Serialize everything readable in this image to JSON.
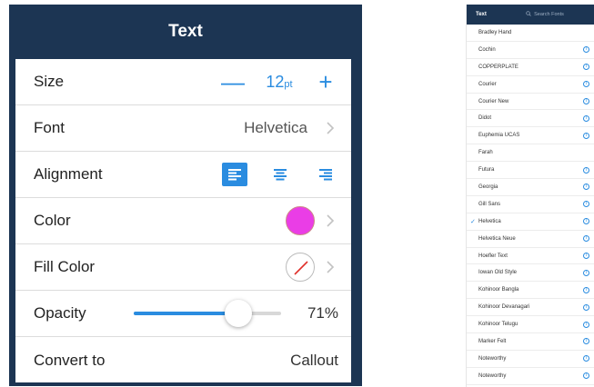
{
  "text_panel": {
    "title": "Text",
    "size": {
      "label": "Size",
      "minus": "—",
      "value": "12",
      "unit": "pt",
      "plus": "+"
    },
    "font": {
      "label": "Font",
      "value": "Helvetica"
    },
    "alignment": {
      "label": "Alignment",
      "selected": "left"
    },
    "color": {
      "label": "Color",
      "swatch": "#ea3de6"
    },
    "fill_color": {
      "label": "Fill Color",
      "swatch": "none"
    },
    "opacity": {
      "label": "Opacity",
      "value_text": "71%",
      "level": 0.71
    },
    "convert_to": {
      "label": "Convert to",
      "value": "Callout"
    }
  },
  "font_list": {
    "tab_label": "Text",
    "search_placeholder": "Search Fonts",
    "fonts": [
      {
        "name": "Bradley Hand",
        "info": false,
        "checked": false
      },
      {
        "name": "Cochin",
        "info": true,
        "checked": false
      },
      {
        "name": "COPPERPLATE",
        "info": true,
        "checked": false
      },
      {
        "name": "Courier",
        "info": true,
        "checked": false
      },
      {
        "name": "Courier New",
        "info": true,
        "checked": false
      },
      {
        "name": "Didot",
        "info": true,
        "checked": false
      },
      {
        "name": "Euphemia UCAS",
        "info": true,
        "checked": false
      },
      {
        "name": "Farah",
        "info": false,
        "checked": false
      },
      {
        "name": "Futura",
        "info": true,
        "checked": false
      },
      {
        "name": "Georgia",
        "info": true,
        "checked": false
      },
      {
        "name": "Gill Sans",
        "info": true,
        "checked": false
      },
      {
        "name": "Helvetica",
        "info": true,
        "checked": true
      },
      {
        "name": "Helvetica Neue",
        "info": true,
        "checked": false
      },
      {
        "name": "Hoefler Text",
        "info": true,
        "checked": false
      },
      {
        "name": "Iowan Old Style",
        "info": true,
        "checked": false
      },
      {
        "name": "Kohinoor Bangla",
        "info": true,
        "checked": false
      },
      {
        "name": "Kohinoor Devanagari",
        "info": true,
        "checked": false
      },
      {
        "name": "Kohinoor Telugu",
        "info": true,
        "checked": false
      },
      {
        "name": "Marker Felt",
        "info": true,
        "checked": false
      },
      {
        "name": "Noteworthy",
        "info": true,
        "checked": false
      },
      {
        "name": "Noteworthy",
        "info": true,
        "checked": false
      }
    ],
    "accent": "#2a8ce0"
  },
  "colors": {
    "header_bg": "#1c3553",
    "accent": "#2a8ce0"
  }
}
